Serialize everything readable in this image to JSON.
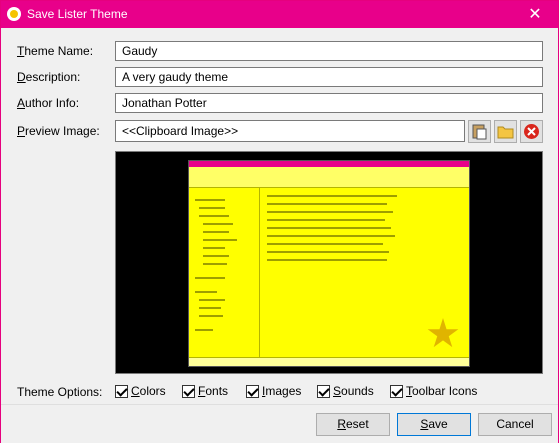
{
  "window": {
    "title": "Save Lister Theme",
    "close_glyph": "✕"
  },
  "fields": {
    "theme_name": {
      "label_u": "T",
      "label_rest": "heme Name:",
      "value": "Gaudy"
    },
    "description": {
      "label_u": "D",
      "label_rest": "escription:",
      "value": "A very gaudy theme"
    },
    "author": {
      "label_u": "A",
      "label_rest": "uthor Info:",
      "value": "Jonathan Potter"
    },
    "preview": {
      "label_u": "P",
      "label_rest": "review Image:",
      "value": "<<Clipboard Image>>"
    }
  },
  "options": {
    "label": "Theme Options:",
    "items": [
      {
        "u": "C",
        "rest": "olors",
        "checked": true
      },
      {
        "u": "F",
        "rest": "onts",
        "checked": true
      },
      {
        "u": "I",
        "rest": "mages",
        "checked": true
      },
      {
        "u": "S",
        "rest": "ounds",
        "checked": true
      },
      {
        "u": "T",
        "pre": "",
        "rest": "oolbar Icons",
        "checked": true
      }
    ]
  },
  "buttons": {
    "reset": {
      "u": "R",
      "rest": "eset"
    },
    "save": {
      "u": "S",
      "rest": "ave"
    },
    "cancel": "Cancel"
  },
  "icons": [
    "paste-icon",
    "folder-icon",
    "clear-icon"
  ],
  "colors": {
    "titlebar": "#e8008a",
    "preview_bg": "#ffff00"
  }
}
